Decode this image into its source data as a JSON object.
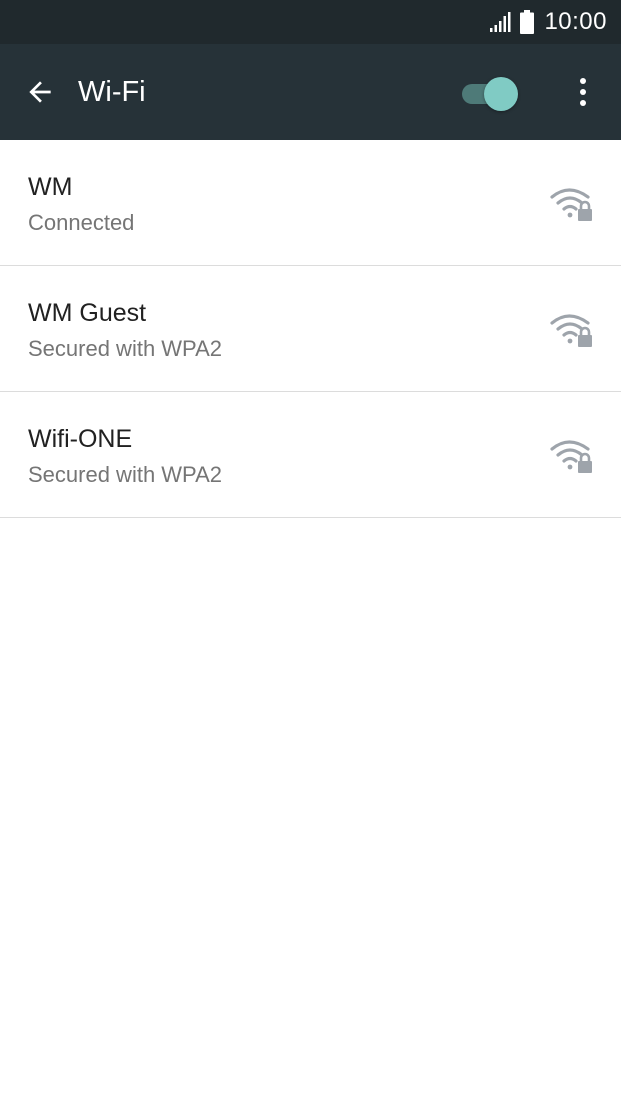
{
  "status_bar": {
    "time": "10:00",
    "icons": [
      "signal-icon",
      "battery-icon"
    ]
  },
  "app_bar": {
    "title": "Wi-Fi",
    "back_icon": "arrow-back-icon",
    "wifi_switch_on": true,
    "overflow_icon": "more-vert-icon"
  },
  "networks": [
    {
      "name": "WM",
      "status": "Connected",
      "icon": "wifi-lock-icon"
    },
    {
      "name": "WM Guest",
      "status": "Secured with WPA2",
      "icon": "wifi-lock-icon"
    },
    {
      "name": "Wifi-ONE",
      "status": "Secured with WPA2",
      "icon": "wifi-lock-icon"
    }
  ],
  "colors": {
    "status_bar_bg": "#20292d",
    "app_bar_bg": "#263238",
    "switch_thumb": "#80cbc4",
    "switch_track": "#4e7a78",
    "wifi_icon": "#9ea4ab"
  }
}
